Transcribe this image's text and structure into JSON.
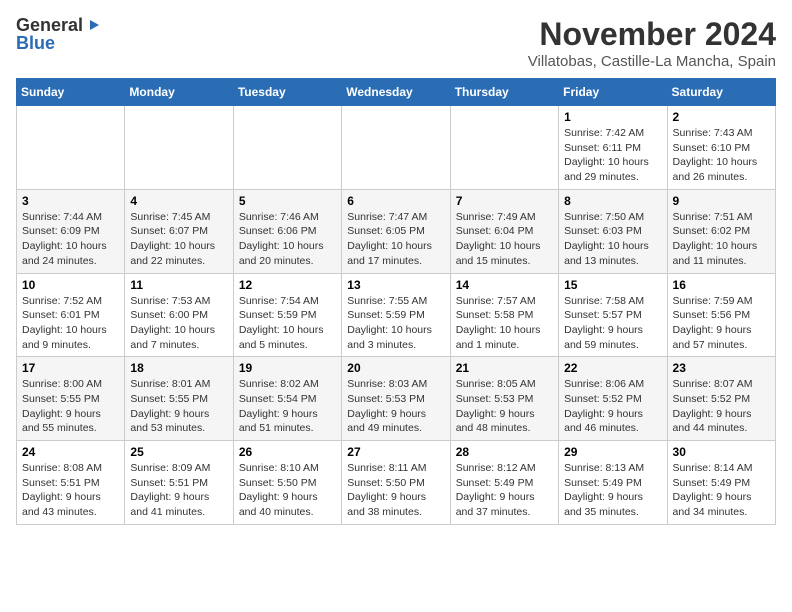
{
  "logo": {
    "general": "General",
    "blue": "Blue"
  },
  "title": "November 2024",
  "location": "Villatobas, Castille-La Mancha, Spain",
  "days_of_week": [
    "Sunday",
    "Monday",
    "Tuesday",
    "Wednesday",
    "Thursday",
    "Friday",
    "Saturday"
  ],
  "weeks": [
    [
      {
        "day": "",
        "info": ""
      },
      {
        "day": "",
        "info": ""
      },
      {
        "day": "",
        "info": ""
      },
      {
        "day": "",
        "info": ""
      },
      {
        "day": "",
        "info": ""
      },
      {
        "day": "1",
        "info": "Sunrise: 7:42 AM\nSunset: 6:11 PM\nDaylight: 10 hours and 29 minutes."
      },
      {
        "day": "2",
        "info": "Sunrise: 7:43 AM\nSunset: 6:10 PM\nDaylight: 10 hours and 26 minutes."
      }
    ],
    [
      {
        "day": "3",
        "info": "Sunrise: 7:44 AM\nSunset: 6:09 PM\nDaylight: 10 hours and 24 minutes."
      },
      {
        "day": "4",
        "info": "Sunrise: 7:45 AM\nSunset: 6:07 PM\nDaylight: 10 hours and 22 minutes."
      },
      {
        "day": "5",
        "info": "Sunrise: 7:46 AM\nSunset: 6:06 PM\nDaylight: 10 hours and 20 minutes."
      },
      {
        "day": "6",
        "info": "Sunrise: 7:47 AM\nSunset: 6:05 PM\nDaylight: 10 hours and 17 minutes."
      },
      {
        "day": "7",
        "info": "Sunrise: 7:49 AM\nSunset: 6:04 PM\nDaylight: 10 hours and 15 minutes."
      },
      {
        "day": "8",
        "info": "Sunrise: 7:50 AM\nSunset: 6:03 PM\nDaylight: 10 hours and 13 minutes."
      },
      {
        "day": "9",
        "info": "Sunrise: 7:51 AM\nSunset: 6:02 PM\nDaylight: 10 hours and 11 minutes."
      }
    ],
    [
      {
        "day": "10",
        "info": "Sunrise: 7:52 AM\nSunset: 6:01 PM\nDaylight: 10 hours and 9 minutes."
      },
      {
        "day": "11",
        "info": "Sunrise: 7:53 AM\nSunset: 6:00 PM\nDaylight: 10 hours and 7 minutes."
      },
      {
        "day": "12",
        "info": "Sunrise: 7:54 AM\nSunset: 5:59 PM\nDaylight: 10 hours and 5 minutes."
      },
      {
        "day": "13",
        "info": "Sunrise: 7:55 AM\nSunset: 5:59 PM\nDaylight: 10 hours and 3 minutes."
      },
      {
        "day": "14",
        "info": "Sunrise: 7:57 AM\nSunset: 5:58 PM\nDaylight: 10 hours and 1 minute."
      },
      {
        "day": "15",
        "info": "Sunrise: 7:58 AM\nSunset: 5:57 PM\nDaylight: 9 hours and 59 minutes."
      },
      {
        "day": "16",
        "info": "Sunrise: 7:59 AM\nSunset: 5:56 PM\nDaylight: 9 hours and 57 minutes."
      }
    ],
    [
      {
        "day": "17",
        "info": "Sunrise: 8:00 AM\nSunset: 5:55 PM\nDaylight: 9 hours and 55 minutes."
      },
      {
        "day": "18",
        "info": "Sunrise: 8:01 AM\nSunset: 5:55 PM\nDaylight: 9 hours and 53 minutes."
      },
      {
        "day": "19",
        "info": "Sunrise: 8:02 AM\nSunset: 5:54 PM\nDaylight: 9 hours and 51 minutes."
      },
      {
        "day": "20",
        "info": "Sunrise: 8:03 AM\nSunset: 5:53 PM\nDaylight: 9 hours and 49 minutes."
      },
      {
        "day": "21",
        "info": "Sunrise: 8:05 AM\nSunset: 5:53 PM\nDaylight: 9 hours and 48 minutes."
      },
      {
        "day": "22",
        "info": "Sunrise: 8:06 AM\nSunset: 5:52 PM\nDaylight: 9 hours and 46 minutes."
      },
      {
        "day": "23",
        "info": "Sunrise: 8:07 AM\nSunset: 5:52 PM\nDaylight: 9 hours and 44 minutes."
      }
    ],
    [
      {
        "day": "24",
        "info": "Sunrise: 8:08 AM\nSunset: 5:51 PM\nDaylight: 9 hours and 43 minutes."
      },
      {
        "day": "25",
        "info": "Sunrise: 8:09 AM\nSunset: 5:51 PM\nDaylight: 9 hours and 41 minutes."
      },
      {
        "day": "26",
        "info": "Sunrise: 8:10 AM\nSunset: 5:50 PM\nDaylight: 9 hours and 40 minutes."
      },
      {
        "day": "27",
        "info": "Sunrise: 8:11 AM\nSunset: 5:50 PM\nDaylight: 9 hours and 38 minutes."
      },
      {
        "day": "28",
        "info": "Sunrise: 8:12 AM\nSunset: 5:49 PM\nDaylight: 9 hours and 37 minutes."
      },
      {
        "day": "29",
        "info": "Sunrise: 8:13 AM\nSunset: 5:49 PM\nDaylight: 9 hours and 35 minutes."
      },
      {
        "day": "30",
        "info": "Sunrise: 8:14 AM\nSunset: 5:49 PM\nDaylight: 9 hours and 34 minutes."
      }
    ]
  ]
}
